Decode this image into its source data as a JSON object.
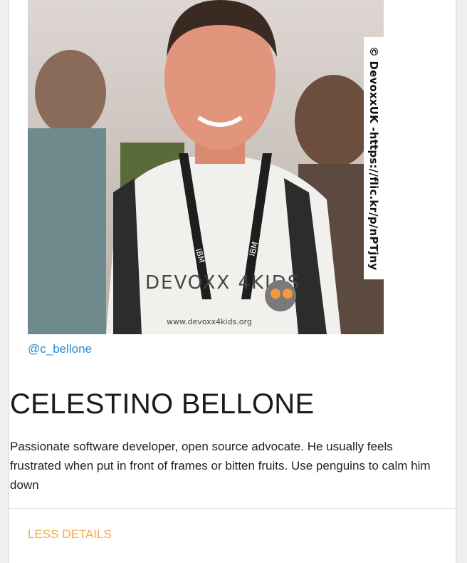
{
  "speaker": {
    "photo_credit": "© DevoxxUK -https://flic.kr/p/nPTjny",
    "shirt_text": "DEVOXX 4KIDS",
    "shirt_url": "www.devoxx4kids.org",
    "lanyard_text": "IBM",
    "twitter_handle": "@c_bellone",
    "name": "CELESTINO BELLONE",
    "bio": "Passionate software developer, open source advocate. He usually feels frustrated when put in front of frames or bitten fruits. Use penguins to calm him down",
    "toggle_label": "LESS DETAILS"
  },
  "colors": {
    "link": "#2a8bd3",
    "toggle": "#f6a94a",
    "text": "#222222"
  }
}
